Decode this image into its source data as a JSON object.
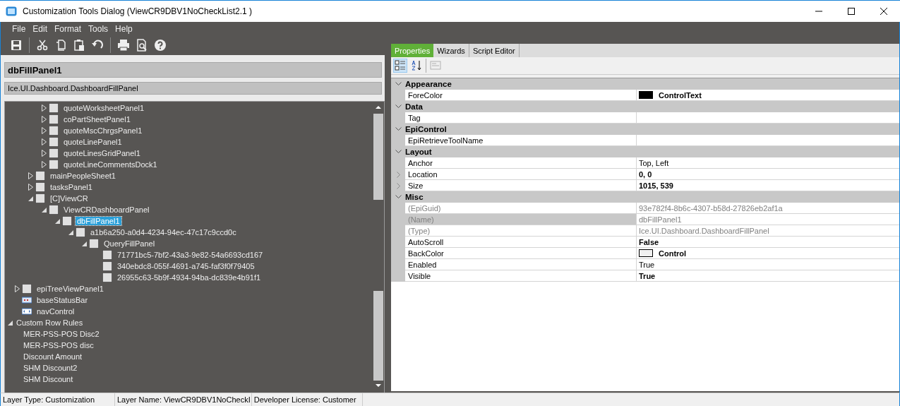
{
  "window": {
    "title": "Customization Tools Dialog  (ViewCR9DBV1NoCheckList2.1 )"
  },
  "menu": [
    "File",
    "Edit",
    "Format",
    "Tools",
    "Help"
  ],
  "toolbar": [
    {
      "kind": "save"
    },
    {
      "kind": "separator"
    },
    {
      "kind": "cut"
    },
    {
      "kind": "copy"
    },
    {
      "kind": "paste"
    },
    {
      "kind": "undo"
    },
    {
      "kind": "separator"
    },
    {
      "kind": "print"
    },
    {
      "kind": "preview"
    },
    {
      "kind": "help"
    }
  ],
  "selected_control": {
    "name": "dbFillPanel1",
    "type": "Ice.UI.Dashboard.DashboardFillPanel"
  },
  "tree": [
    {
      "children": [
        {
          "children": [
            {
              "children": [
                {
                  "label": "quoteWorksheetPanel1",
                  "kind": "panel",
                  "expanded": false,
                  "selected": false
                },
                {
                  "label": "coPartSheetPanel1",
                  "kind": "panel",
                  "expanded": false,
                  "selected": false
                },
                {
                  "label": "quoteMscChrgsPanel1",
                  "kind": "panel",
                  "expanded": false,
                  "selected": false
                },
                {
                  "label": "quoteLinePanel1",
                  "kind": "panel",
                  "expanded": false,
                  "selected": false
                },
                {
                  "label": "quoteLinesGridPanel1",
                  "kind": "panel",
                  "expanded": false,
                  "selected": false
                },
                {
                  "label": "quoteLineCommentsDock1",
                  "kind": "panel",
                  "expanded": false,
                  "selected": false
                }
              ]
            },
            {
              "label": "mainPeopleSheet1",
              "kind": "panel",
              "expanded": false,
              "selected": false
            },
            {
              "label": "tasksPanel1",
              "kind": "panel",
              "expanded": false,
              "selected": false
            },
            {
              "label": "[C]ViewCR",
              "kind": "panel",
              "expanded": true,
              "selected": false,
              "children": [
                {
                  "label": "ViewCRDashboardPanel",
                  "kind": "panel",
                  "expanded": true,
                  "selected": false,
                  "children": [
                    {
                      "label": "dbFillPanel1",
                      "kind": "panel",
                      "expanded": true,
                      "selected": true,
                      "children": [
                        {
                          "label": "a1b6a250-a0d4-4234-94ec-47c17c9ccd0c",
                          "kind": "panel",
                          "expanded": true,
                          "selected": false,
                          "children": [
                            {
                              "label": "QueryFillPanel",
                              "kind": "panel",
                              "expanded": true,
                              "selected": false,
                              "children": [
                                {
                                  "label": "71771bc5-7bf2-43a3-9e82-54a6693cd167",
                                  "kind": "panel",
                                  "selected": false
                                },
                                {
                                  "label": "340ebdc8-055f-4691-a745-faf3f0f79405",
                                  "kind": "panel",
                                  "selected": false
                                },
                                {
                                  "label": "26955c63-5b9f-4934-94ba-dc839e4b91f1",
                                  "kind": "panel",
                                  "selected": false
                                }
                              ]
                            }
                          ]
                        }
                      ]
                    }
                  ]
                }
              ]
            }
          ]
        },
        {
          "label": "epiTreeViewPanel1",
          "kind": "panel",
          "expanded": false,
          "selected": false
        },
        {
          "label": "baseStatusBar",
          "kind": "statusbar",
          "selected": false
        },
        {
          "label": "navControl",
          "kind": "nav",
          "selected": false
        }
      ]
    },
    {
      "label": "Custom Row Rules",
      "expanded": true,
      "selected": false,
      "children": [
        {
          "label": "MER-PSS-POS Disc2",
          "selected": false
        },
        {
          "label": "MER-PSS-POS disc",
          "selected": false
        },
        {
          "label": "Discount Amount",
          "selected": false
        },
        {
          "label": "SHM Discount2",
          "selected": false
        },
        {
          "label": "SHM Discount",
          "selected": false
        }
      ]
    }
  ],
  "tabs": [
    {
      "label": "Properties",
      "selected": true
    },
    {
      "label": "Wizards",
      "selected": false
    },
    {
      "label": "Script Editor",
      "selected": false
    }
  ],
  "grid_toolbar": [
    {
      "kind": "categorized",
      "selected": true,
      "disabled": false
    },
    {
      "kind": "alphabetical",
      "selected": false,
      "disabled": false
    },
    {
      "kind": "separator"
    },
    {
      "kind": "property-pages",
      "selected": false,
      "disabled": true
    }
  ],
  "properties": [
    {
      "category": "Appearance",
      "expanded": true,
      "rows": [
        {
          "name": "ForeColor",
          "value": "ControlText",
          "color": "#000000",
          "bold": true,
          "readonly": false,
          "selected": false
        }
      ]
    },
    {
      "category": "Data",
      "expanded": true,
      "rows": [
        {
          "name": "Tag",
          "readonly": false,
          "selected": false
        }
      ]
    },
    {
      "category": "EpiControl",
      "expanded": true,
      "rows": [
        {
          "name": "EpiRetrieveToolName",
          "readonly": false,
          "selected": false
        }
      ]
    },
    {
      "category": "Layout",
      "expanded": true,
      "rows": [
        {
          "name": "Anchor",
          "value": "Top, Left",
          "bold": false,
          "readonly": false,
          "selected": false
        },
        {
          "name": "Location",
          "value": "0, 0",
          "bold": true,
          "readonly": false,
          "expandable": true,
          "selected": false
        },
        {
          "name": "Size",
          "value": "1015, 539",
          "bold": true,
          "readonly": false,
          "expandable": true,
          "selected": false
        }
      ]
    },
    {
      "category": "Misc",
      "expanded": true,
      "rows": [
        {
          "name": "(EpiGuid)",
          "value": "93e782f4-8b6c-4307-b58d-27826eb2af1a",
          "bold": false,
          "readonly": true,
          "selected": false
        },
        {
          "name": "(Name)",
          "value": "dbFillPanel1",
          "bold": false,
          "readonly": true,
          "selected": true
        },
        {
          "name": "(Type)",
          "value": "Ice.UI.Dashboard.DashboardFillPanel",
          "bold": false,
          "readonly": true,
          "selected": false
        },
        {
          "name": "AutoScroll",
          "value": "False",
          "bold": true,
          "readonly": false,
          "selected": false
        },
        {
          "name": "BackColor",
          "value": "Control",
          "color": "#f0f0f0",
          "bold": true,
          "readonly": false,
          "selected": false
        },
        {
          "name": "Enabled",
          "value": "True",
          "bold": false,
          "readonly": false,
          "selected": false
        },
        {
          "name": "Visible",
          "value": "True",
          "bold": true,
          "readonly": false,
          "selected": false
        }
      ]
    }
  ],
  "status_bar": [
    "Layer Type:  Customization",
    "Layer Name:  ViewCR9DBV1NoCheckI",
    "Developer License:  Customer"
  ]
}
